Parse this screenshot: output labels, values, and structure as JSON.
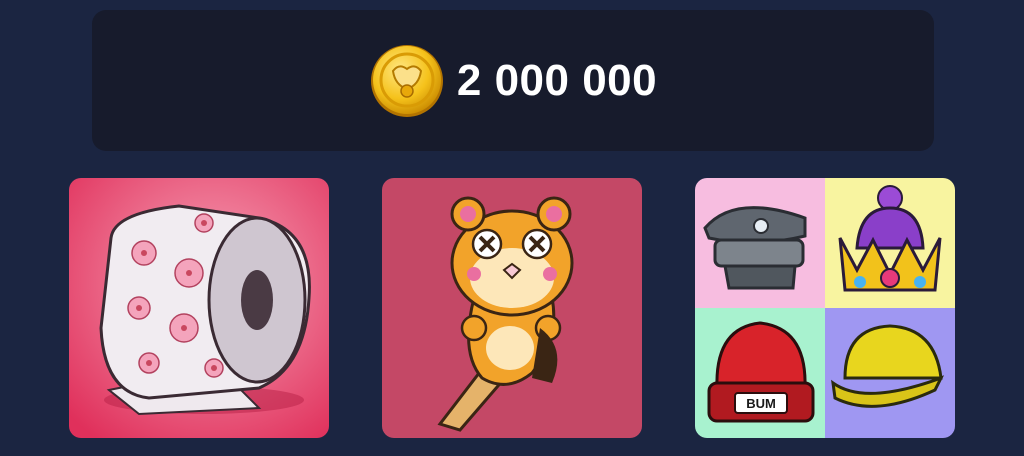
{
  "balance": {
    "icon": "coin-icon",
    "amount": "2 000 000"
  },
  "items": [
    {
      "icon": "toilet-paper-icon"
    },
    {
      "icon": "hamster-popsicle-icon"
    },
    {
      "icon": "hats-bundle-icon",
      "hats": [
        {
          "icon": "police-cap-icon"
        },
        {
          "icon": "crown-beanie-icon"
        },
        {
          "icon": "red-beanie-icon",
          "label": "BUM"
        },
        {
          "icon": "yellow-cap-icon"
        }
      ]
    }
  ],
  "colors": {
    "background": "#1b2541",
    "panel": "#171b2c",
    "card_pink": "#e83d68",
    "card_rose": "#c44866"
  }
}
